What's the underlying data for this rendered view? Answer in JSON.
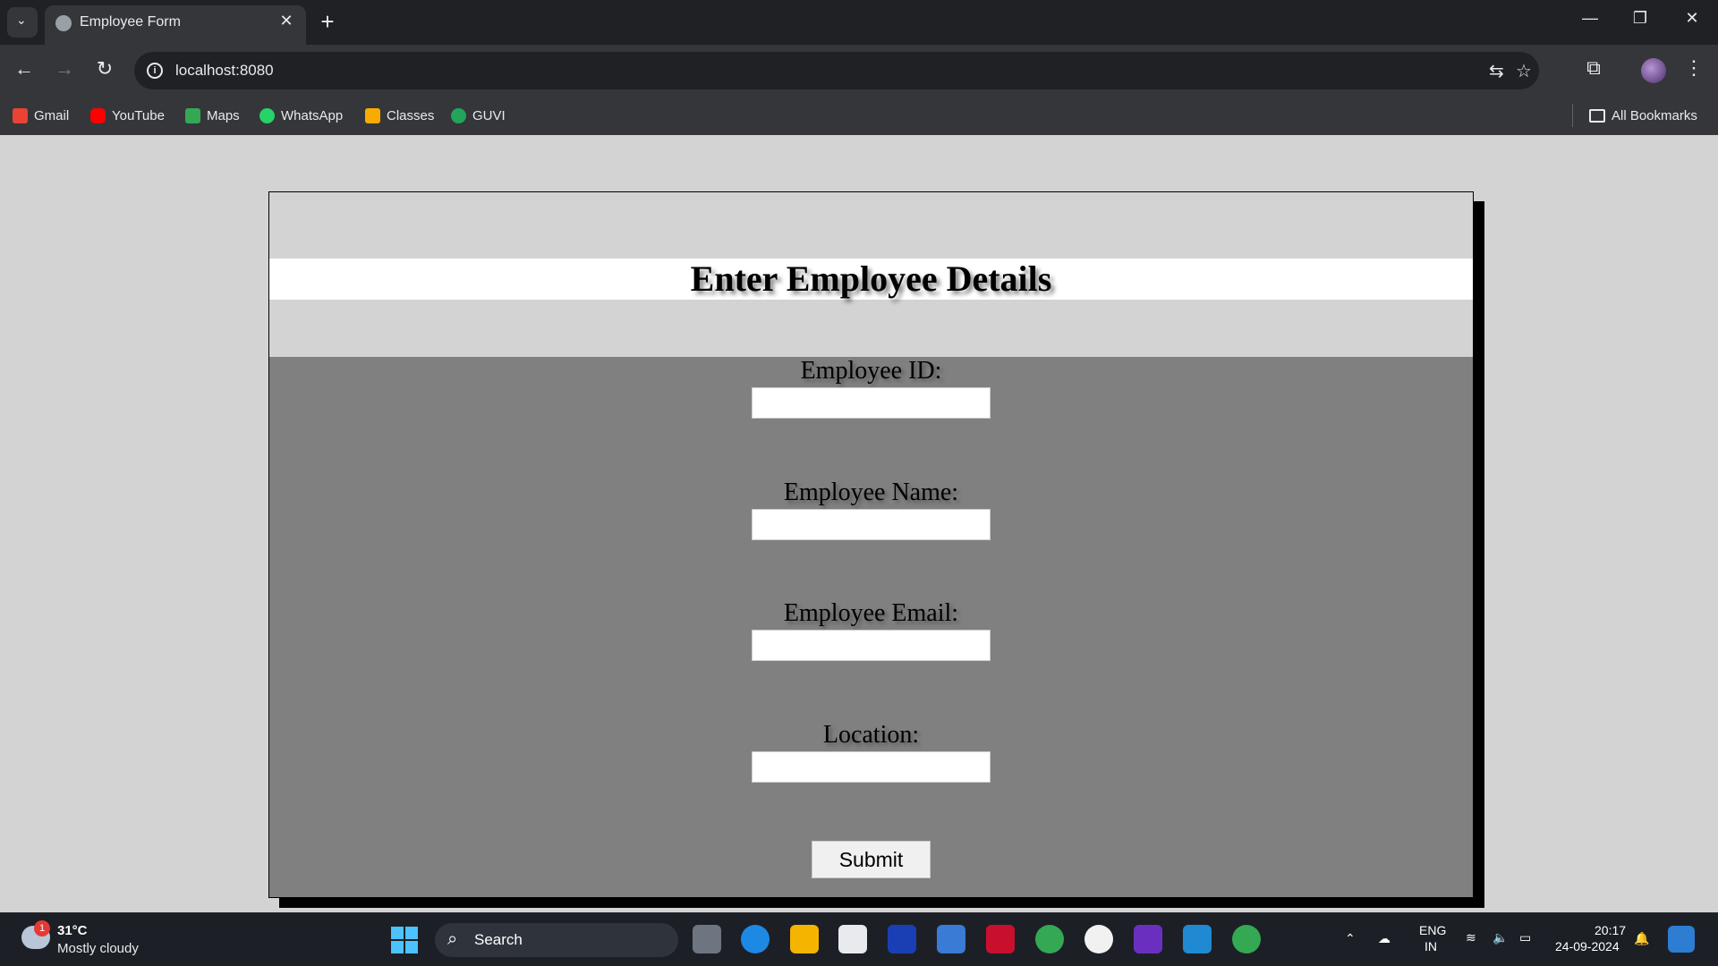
{
  "browser": {
    "tab_title": "Employee Form",
    "tab_close": "✕",
    "new_tab": "+",
    "url": "localhost:8080",
    "bookmarks": [
      "Gmail",
      "YouTube",
      "Maps",
      "WhatsApp",
      "Classes",
      "GUVI"
    ],
    "all_bookmarks": "All Bookmarks"
  },
  "form": {
    "heading": "Enter Employee Details",
    "fields": [
      {
        "label": "Employee ID:",
        "value": ""
      },
      {
        "label": "Employee Name:",
        "value": ""
      },
      {
        "label": "Employee Email:",
        "value": ""
      },
      {
        "label": "Location:",
        "value": ""
      }
    ],
    "submit_label": "Submit"
  },
  "taskbar": {
    "weather_temp": "31°C",
    "weather_desc": "Mostly cloudy",
    "weather_badge": "1",
    "search_label": "Search",
    "lang_top": "ENG",
    "lang_bottom": "IN",
    "time": "20:17",
    "date": "24-09-2024"
  },
  "colors": {
    "page_bg": "#d3d3d3",
    "form_bg": "#808080",
    "heading_band": "#ffffff",
    "card_shadow": "#000000"
  }
}
